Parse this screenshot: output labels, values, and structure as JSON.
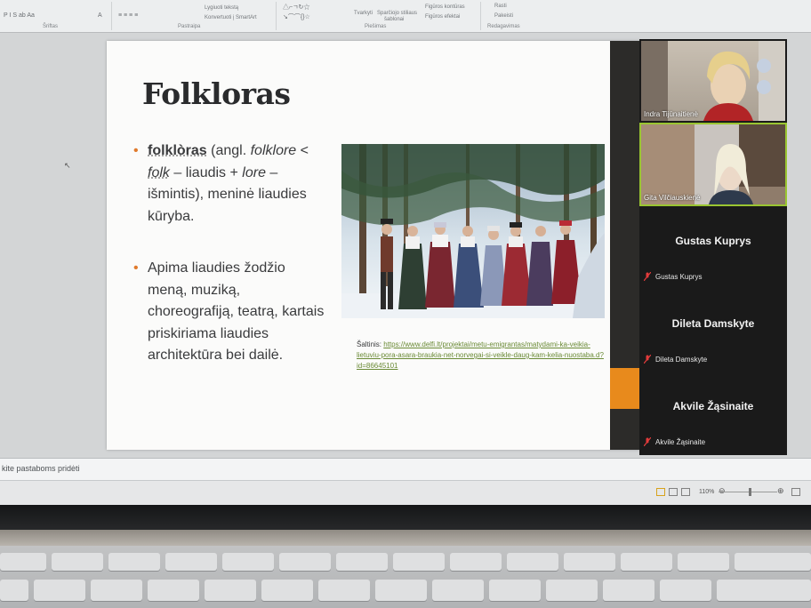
{
  "ribbon": {
    "groups": [
      "Šriftas",
      "Pastraipa",
      "Piešimas",
      "Redagavimas"
    ],
    "items": {
      "align_text": "Lygiuoti tekstą",
      "convert_smartart": "Konvertuoti į SmartArt",
      "arrange": "Tvarkyti",
      "quick_styles": "Sparčiojo stiliaus",
      "quick_styles_line2": "šablonai",
      "shape_outline": "Figūros kontūras",
      "shape_effects": "Figūros efektai",
      "find": "Rasti",
      "replace": "Pakeisti"
    }
  },
  "slide": {
    "title": "Folkloras",
    "bullet1": {
      "term": "folklòras",
      "p1": " (angl. ",
      "i1": "folklore",
      "p2": " < ",
      "i2": "folk",
      "p3": " – liaudis + ",
      "i3": "lore",
      "p4": " – išmintis), meninė liaudies kūryba."
    },
    "bullet2": "Apima liaudies žodžio meną, muziką, choreografiją, teatrą, kartais priskiriama liaudies architektūra bei dailė.",
    "source_label": "Šaltinis:",
    "source_url": "https://www.delfi.lt/projektai/metu-emigrantas/matydami-ka-veikia-lietuviu-pora-asara-braukia-net-norvegai-si-veikle-daug-kam-kelia-nuostaba.d?id=86645101"
  },
  "participants": [
    {
      "name": "Indra Tijūnaitienė",
      "video": true
    },
    {
      "name": "Gita Vilčiauskienė",
      "video": true,
      "active": true
    },
    {
      "name": "Gustas Kuprys",
      "video": false,
      "muted": true
    },
    {
      "name": "Dileta Damskyte",
      "video": false,
      "muted": true
    },
    {
      "name": "Akvile Žąsinaite",
      "video": false,
      "muted": true
    }
  ],
  "notes_placeholder": "kite pastaboms pridėti",
  "status": {
    "zoom": "110%"
  },
  "colors": {
    "accent_orange": "#e88a1c",
    "bullet_orange": "#e07a2c",
    "active_speaker": "#9ac531"
  }
}
